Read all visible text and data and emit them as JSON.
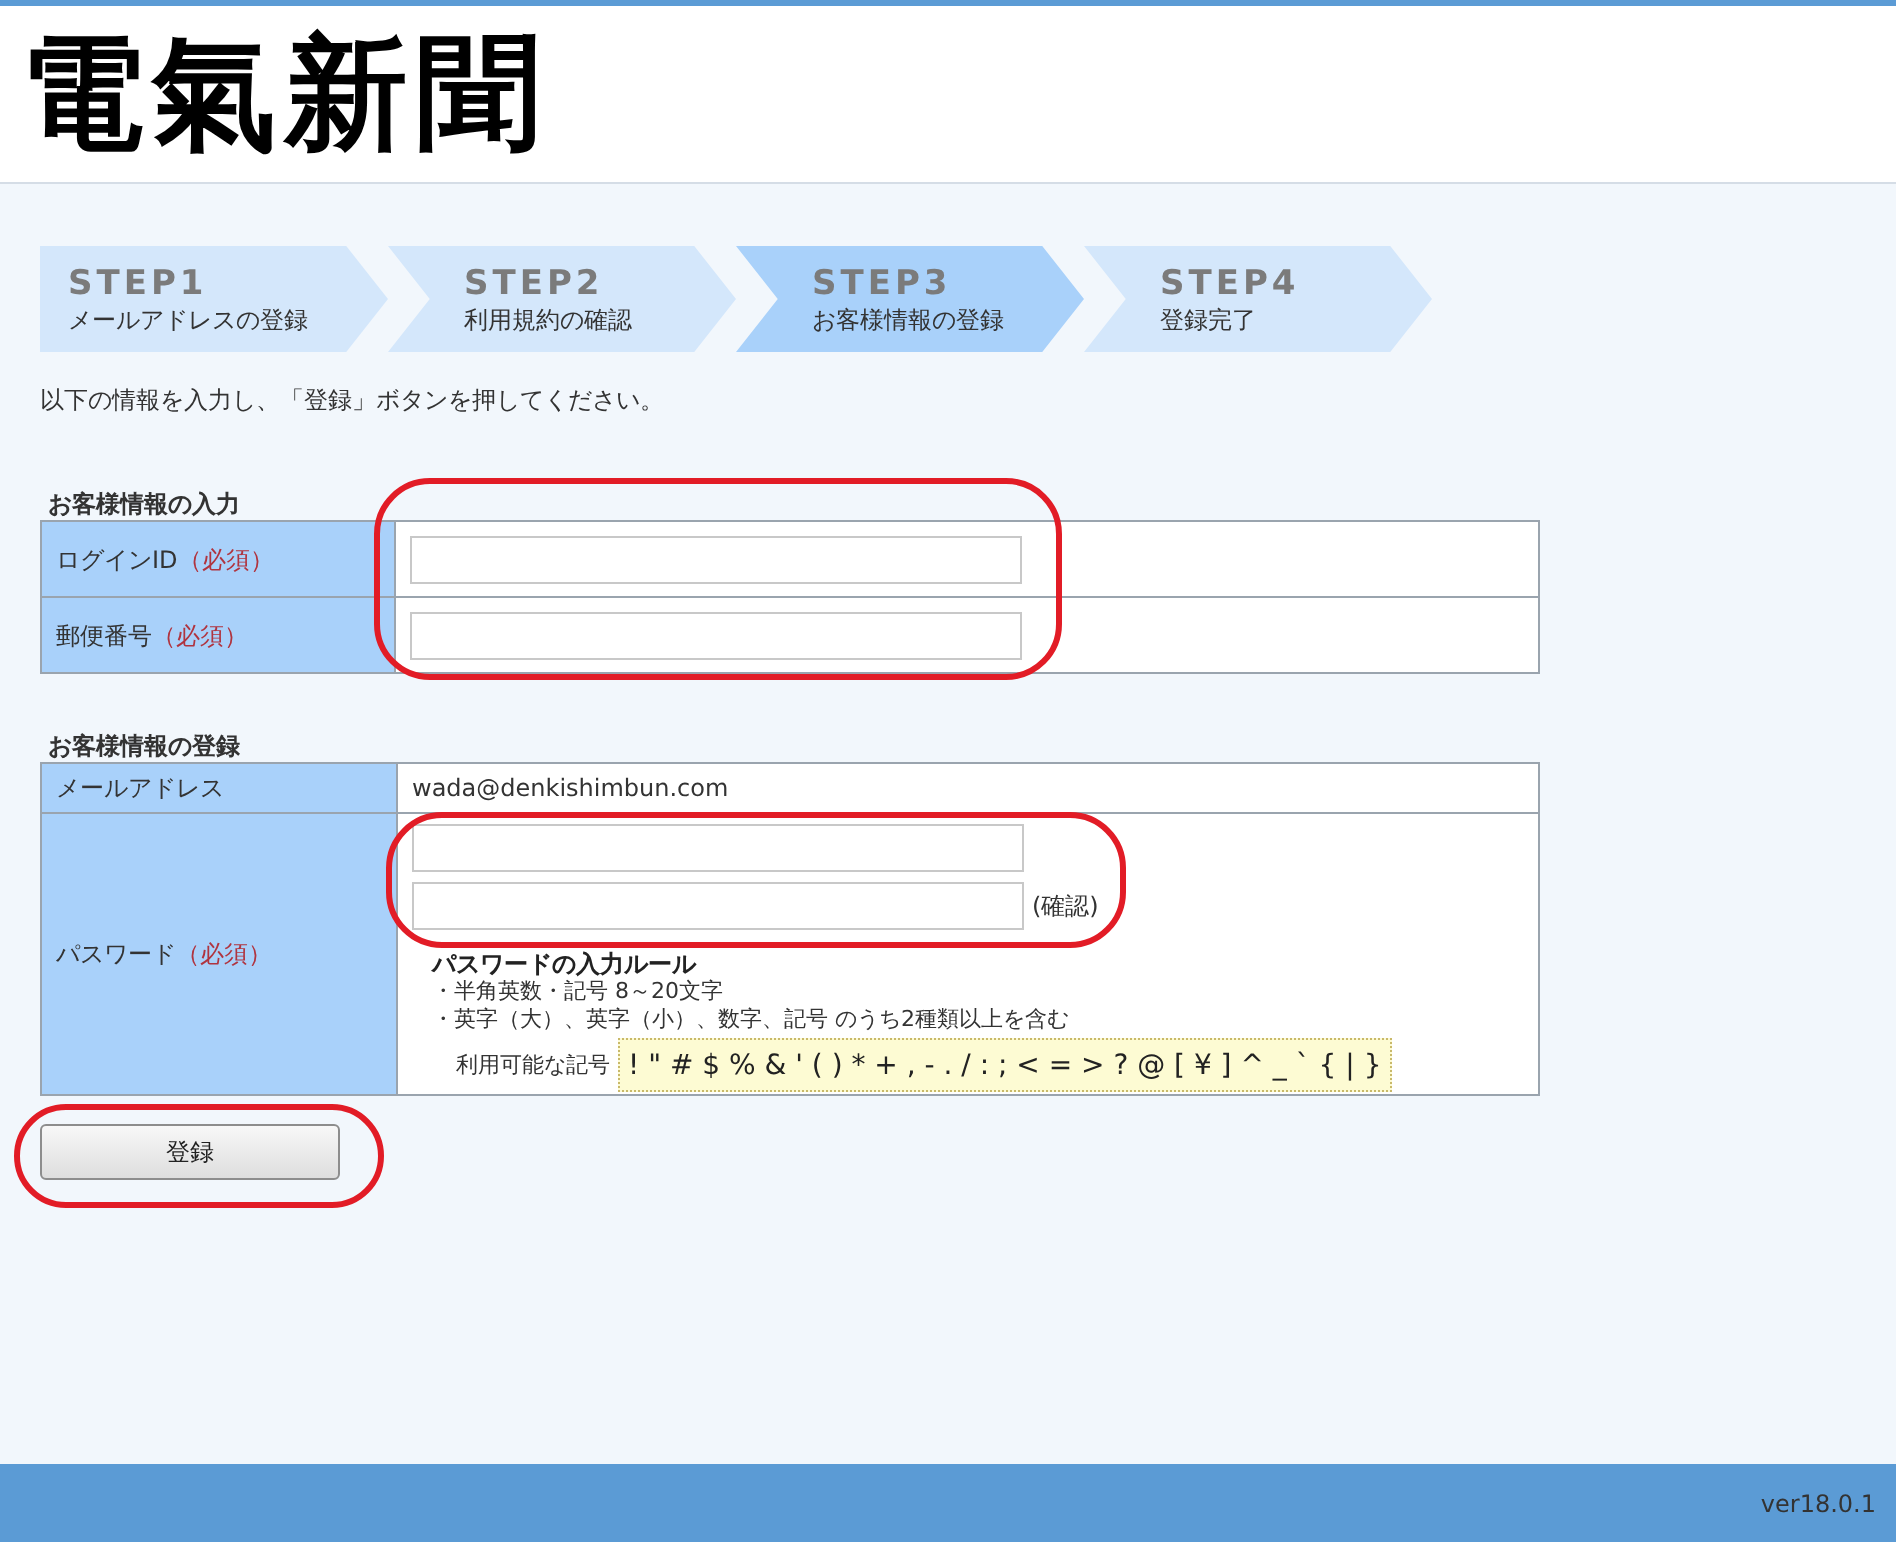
{
  "header": {
    "logo": "電氣新聞"
  },
  "steps": [
    {
      "title": "STEP1",
      "label": "メールアドレスの登録",
      "selected": false
    },
    {
      "title": "STEP2",
      "label": "利用規約の確認",
      "selected": false
    },
    {
      "title": "STEP3",
      "label": "お客様情報の登録",
      "selected": true
    },
    {
      "title": "STEP4",
      "label": "登録完了",
      "selected": false
    }
  ],
  "instruction": "以下の情報を入力し、「登録」ボタンを押してください。",
  "input_section": {
    "heading": "お客様情報の入力",
    "highlighted": true,
    "rows": [
      {
        "label": "ログインID",
        "required": "（必須）"
      },
      {
        "label": "郵便番号",
        "required": "（必須）"
      }
    ]
  },
  "register_section": {
    "heading": "お客様情報の登録",
    "email": {
      "label": "メールアドレス",
      "value": "wada@denkishimbun.com"
    },
    "password": {
      "label": "パスワード",
      "required": "（必須）",
      "highlighted": true,
      "confirm_label": "(確認)",
      "rules_title": "パスワードの入力ルール",
      "rules": [
        "・半角英数・記号 8～20文字",
        "・英字（大）、英字（小）、数字、記号 のうち2種類以上を含む"
      ],
      "symbols_label": "利用可能な記号",
      "symbols": "! \" # $ % & ' ( ) * + , - . / : ; < = > ? @ [ ¥ ] ^ _ ` { | }"
    }
  },
  "submit": {
    "label": "登録",
    "highlighted": true
  },
  "footer": {
    "version": "ver18.0.1"
  }
}
